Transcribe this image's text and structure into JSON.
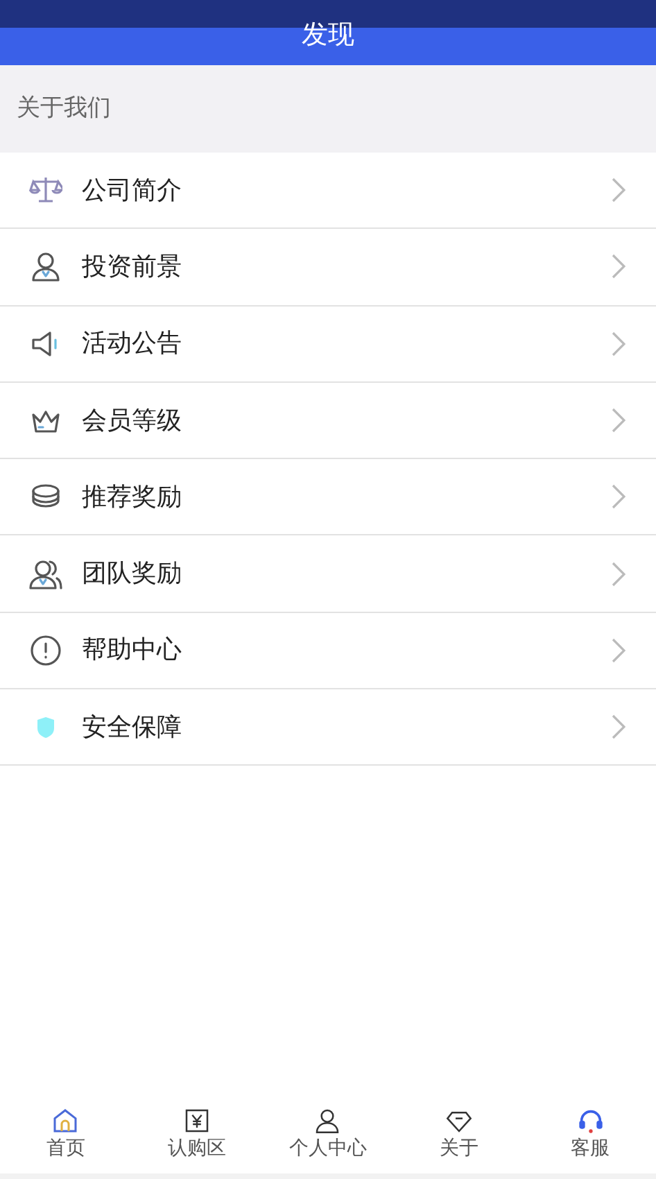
{
  "header": {
    "title": "发现"
  },
  "section": {
    "label": "关于我们"
  },
  "menu": [
    {
      "label": "公司简介"
    },
    {
      "label": "投资前景"
    },
    {
      "label": "活动公告"
    },
    {
      "label": "会员等级"
    },
    {
      "label": "推荐奖励"
    },
    {
      "label": "团队奖励"
    },
    {
      "label": "帮助中心"
    },
    {
      "label": "安全保障"
    }
  ],
  "tab_bar": [
    {
      "label": "首页"
    },
    {
      "label": "认购区"
    },
    {
      "label": "个人中心"
    },
    {
      "label": "关于"
    },
    {
      "label": "客服"
    }
  ]
}
